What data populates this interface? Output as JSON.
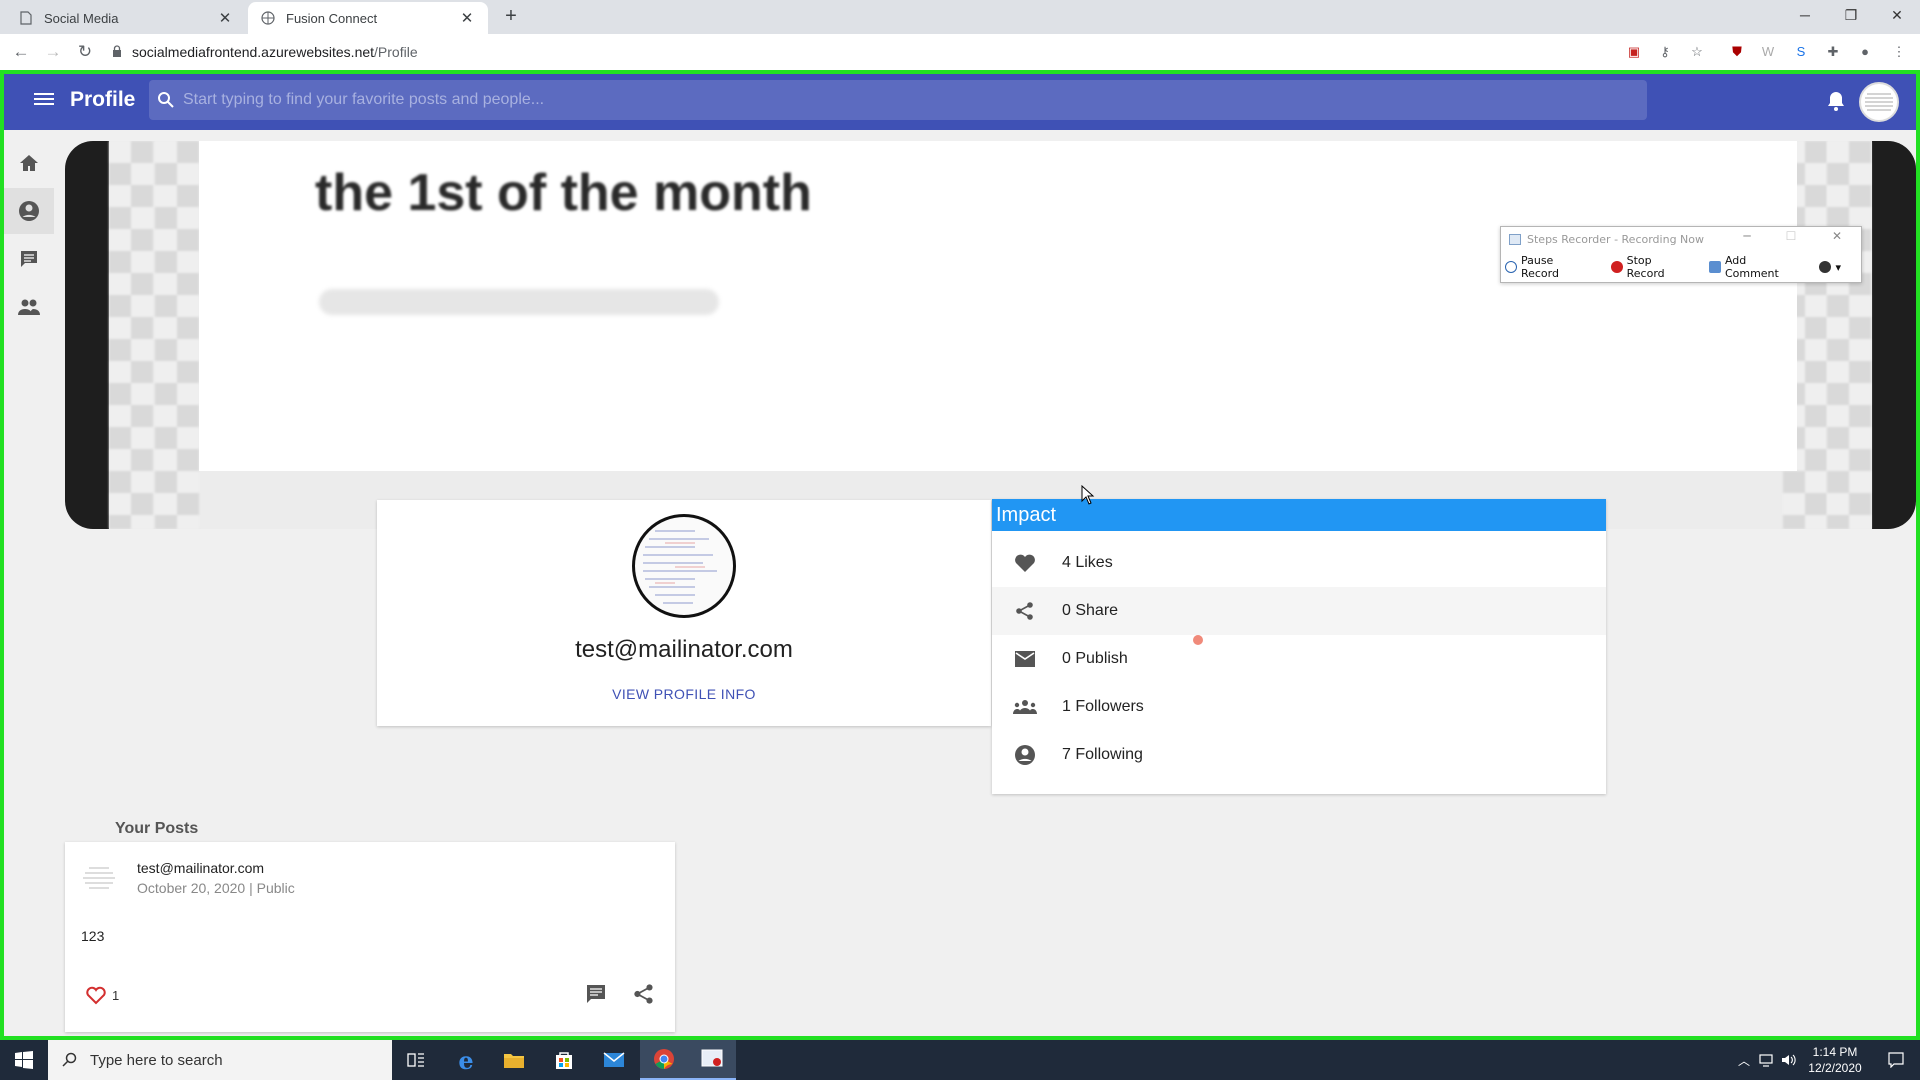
{
  "browser": {
    "tabs": [
      {
        "label": "Social Media",
        "active": false
      },
      {
        "label": "Fusion Connect",
        "active": true
      }
    ],
    "url_host": "socialmediafrontend.azurewebsites.net",
    "url_path": "/Profile"
  },
  "appbar": {
    "title": "Profile",
    "search_placeholder": "Start typing to find your favorite posts and people..."
  },
  "cover": {
    "headline": "the 1st of the month"
  },
  "steps_recorder": {
    "title": "Steps Recorder - Recording Now",
    "pause": "Pause Record",
    "stop": "Stop Record",
    "comment": "Add Comment"
  },
  "profile": {
    "email": "test@mailinator.com",
    "view_info": "VIEW PROFILE INFO"
  },
  "impact": {
    "title": "Impact",
    "rows": [
      {
        "icon": "heart-icon",
        "label": "4 Likes"
      },
      {
        "icon": "share-icon",
        "label": "0 Share"
      },
      {
        "icon": "mail-icon",
        "label": "0 Publish"
      },
      {
        "icon": "followers-icon",
        "label": "1 Followers"
      },
      {
        "icon": "account-circle-icon",
        "label": "7 Following"
      }
    ]
  },
  "posts": {
    "heading": "Your Posts",
    "items": [
      {
        "author": "test@mailinator.com",
        "meta": "October 20, 2020 | Public",
        "body": "123",
        "likes": "1"
      }
    ]
  },
  "taskbar": {
    "search_placeholder": "Type here to search",
    "time": "1:14 PM",
    "date": "12/2/2020"
  },
  "colors": {
    "appbar": "#3f51b5",
    "impact_header": "#2196f3",
    "frame_border": "#22e022"
  }
}
